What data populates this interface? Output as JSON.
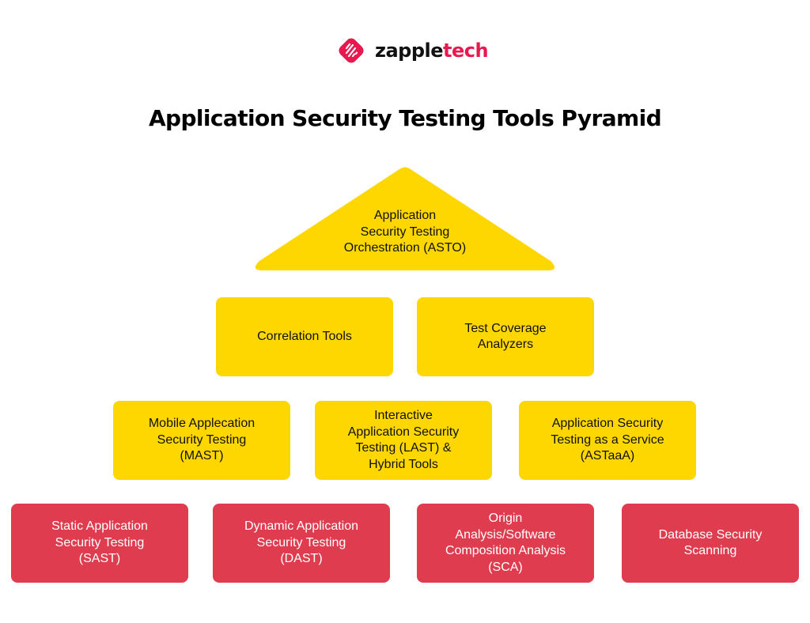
{
  "brand": {
    "name_part1": "zapple",
    "name_part2": "tech",
    "icon": "zappletech-logo-icon",
    "colors": {
      "brand_pink": "#e8194f"
    }
  },
  "title": "Application Security Testing Tools Pyramid",
  "colors": {
    "tier_yellow": "#fed700",
    "tier_red": "#df3d4f"
  },
  "pyramid": {
    "apex": {
      "label": "Application\nSecurity Testing\nOrchestration (ASTO)"
    },
    "tier2": [
      {
        "label": "Correlation Tools"
      },
      {
        "label": "Test Coverage\nAnalyzers"
      }
    ],
    "tier3": [
      {
        "label": "Mobile Applecation\nSecurity Testing\n(MAST)"
      },
      {
        "label": "Interactive\nApplication Security\nTesting (LAST) &\nHybrid Tools"
      },
      {
        "label": "Application Security\nTesting as a Service\n(ASTaaA)"
      }
    ],
    "base": [
      {
        "label": "Static Application\nSecurity Testing\n(SAST)"
      },
      {
        "label": "Dynamic Application\nSecurity Testing\n(DAST)"
      },
      {
        "label": "Origin\nAnalysis/Software\nComposition Analysis\n(SCA)"
      },
      {
        "label": "Database Security\nScanning"
      }
    ]
  }
}
